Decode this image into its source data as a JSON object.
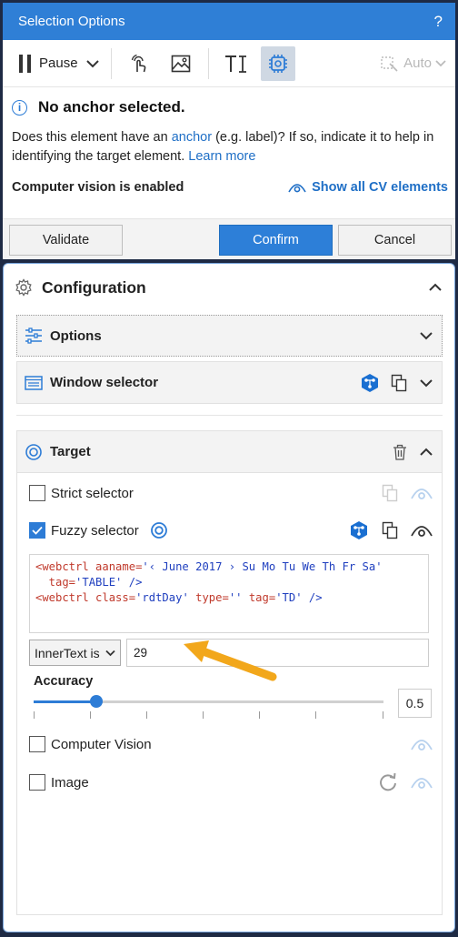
{
  "header": {
    "title": "Selection Options",
    "help": "?"
  },
  "toolbar": {
    "pause_label": "Pause",
    "auto_label": "Auto"
  },
  "anchor": {
    "title": "No anchor selected.",
    "desc_before": "Does this element have an ",
    "desc_link": "anchor",
    "desc_after": " (e.g. label)? If so, indicate it to help in identifying the target element. ",
    "learn_more": "Learn more"
  },
  "cv": {
    "status": "Computer vision is enabled",
    "show_all": "Show all CV elements"
  },
  "buttons": {
    "validate": "Validate",
    "confirm": "Confirm",
    "cancel": "Cancel"
  },
  "config": {
    "title": "Configuration",
    "options_label": "Options",
    "window_selector_label": "Window selector"
  },
  "target": {
    "title": "Target",
    "strict_label": "Strict selector",
    "fuzzy_label": "Fuzzy selector",
    "code_l1_tag": "<webctrl",
    "code_l1_attr": " aaname=",
    "code_l1_val": "'‹ June 2017 › Su Mo Tu We Th Fr Sa'",
    "code_l2_attr": "  tag=",
    "code_l2_val": "'TABLE'",
    "code_l2_end": " />",
    "code_l3_tag": "<webctrl",
    "code_l3_attr1": " class=",
    "code_l3_val1": "'rdtDay'",
    "code_l3_attr2": " type=",
    "code_l3_val2": "''",
    "code_l3_attr3": " tag=",
    "code_l3_val3": "'TD'",
    "code_l3_end": " />",
    "property_select": "InnerText is",
    "property_value": "29",
    "accuracy_label": "Accuracy",
    "accuracy_value": "0.5",
    "accuracy_fraction": 0.18,
    "cv_label": "Computer Vision",
    "image_label": "Image"
  },
  "colors": {
    "accent": "#2d7cd6",
    "titlebar": "#2f7fd6",
    "arrow": "#f2a71b"
  }
}
